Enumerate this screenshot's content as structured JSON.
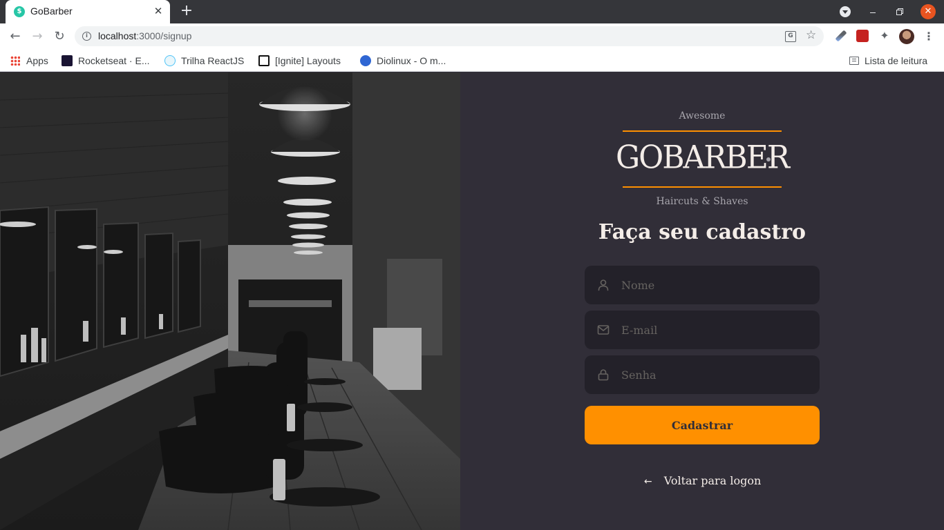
{
  "browser": {
    "tab_title": "GoBarber",
    "tab_favicon": "$",
    "url_host": "localhost",
    "url_rest": ":3000/signup",
    "bookmarks": [
      {
        "label": "Apps"
      },
      {
        "label": "Rocketseat · E..."
      },
      {
        "label": "Trilha ReactJS"
      },
      {
        "label": "[Ignite] Layouts"
      },
      {
        "label": "Diolinux - O m..."
      }
    ],
    "reading_list": "Lista de leitura",
    "icons": {
      "back": "←",
      "forward": "→",
      "reload": "↻",
      "info": "i",
      "translate": "G",
      "star": "☆",
      "puzzle": "✦",
      "menu": "⋮",
      "new_tab": "+",
      "close_tab": "✕",
      "close_window": "✕"
    }
  },
  "logo": {
    "top_text": "Awesome",
    "main_text": "GOBARBER",
    "bottom_text": "Haircuts & Shaves",
    "accent_color": "#ff9000"
  },
  "form": {
    "title": "Faça seu cadastro",
    "fields": {
      "name_placeholder": "Nome",
      "email_placeholder": "E-mail",
      "password_placeholder": "Senha"
    },
    "submit_label": "Cadastrar",
    "back_label": "Voltar para logon",
    "back_arrow": "←"
  },
  "colors": {
    "background": "#312e38",
    "input_bg": "#232129",
    "placeholder": "#666360",
    "text": "#f4ede8",
    "orange": "#ff9000"
  }
}
